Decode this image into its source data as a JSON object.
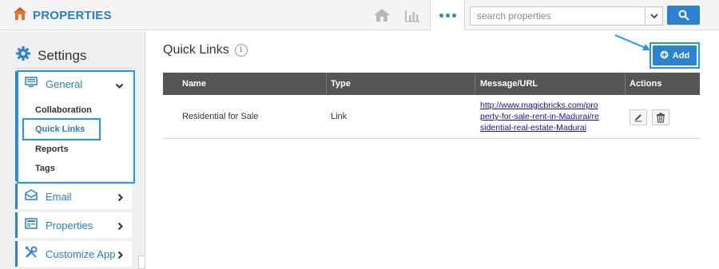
{
  "app": {
    "title": "PROPERTIES"
  },
  "search": {
    "placeholder": "search properties"
  },
  "icons": {
    "logo": "house-logo-icon",
    "home": "home-icon",
    "chart": "bar-chart-icon",
    "more": "more-dots-icon",
    "search": "search-icon",
    "settings": "gear-icon",
    "info": "info-icon",
    "add": "plus-circle-icon",
    "edit": "pencil-icon",
    "delete": "trash-icon"
  },
  "colors": {
    "accent": "#2a82d1",
    "highlight": "#2196f3",
    "table_header": "#555555"
  },
  "sidebar": {
    "title": "Settings",
    "general": {
      "label": "General",
      "subitems": [
        "Collaboration",
        "Quick Links",
        "Reports",
        "Tags"
      ]
    },
    "items": [
      {
        "label": "Email"
      },
      {
        "label": "Properties"
      },
      {
        "label": "Customize App"
      }
    ]
  },
  "main": {
    "title": "Quick Links",
    "info_glyph": "i",
    "add_label": "Add",
    "table": {
      "columns": [
        "Name",
        "Type",
        "Message/URL",
        "Actions"
      ],
      "rows": [
        {
          "name": "Residential for Sale",
          "type": "Link",
          "url": "http://www.magicbricks.com/property-for-sale-rent-in-Madurai/residential-real-estate-Madurai"
        }
      ]
    }
  }
}
